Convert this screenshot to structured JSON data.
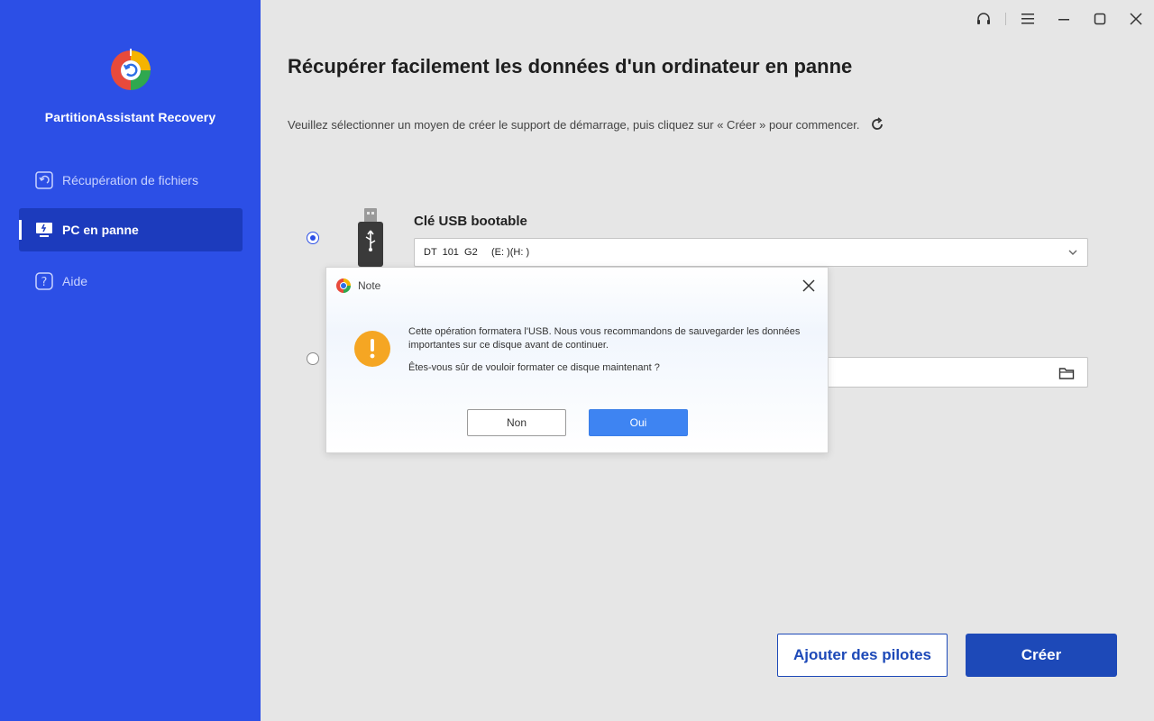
{
  "sidebar": {
    "app_name": "PartitionAssistant Recovery",
    "logo_icon": "recovery-logo-icon",
    "items": [
      {
        "label": "Récupération de fichiers",
        "icon": "file-restore-icon",
        "active": false
      },
      {
        "label": "PC en panne",
        "icon": "broken-pc-icon",
        "active": true
      },
      {
        "label": "Aide",
        "icon": "help-icon",
        "active": false
      }
    ]
  },
  "titlebar": {
    "icons": [
      "headset-icon",
      "menu-icon",
      "minimize-icon",
      "maximize-icon",
      "close-icon"
    ]
  },
  "main": {
    "title": "Récupérer facilement les données d'un ordinateur en panne",
    "subtitle": "Veuillez sélectionner un moyen de créer le support de démarrage, puis cliquez sur « Créer » pour commencer.",
    "usb_option": {
      "label": "Clé USB bootable",
      "selected": true,
      "select_value": "DT  101  G2     (E: )(H: )"
    },
    "iso_option": {
      "selected": false
    },
    "buttons": {
      "drivers": "Ajouter des pilotes",
      "create": "Créer"
    }
  },
  "dialog": {
    "title": "Note",
    "message": "Cette opération formatera l'USB. Nous vous recommandons de sauvegarder les données importantes sur ce disque avant de continuer.",
    "question": "Êtes-vous sûr de vouloir formater ce disque maintenant ?",
    "buttons": {
      "no": "Non",
      "yes": "Oui"
    }
  },
  "colors": {
    "sidebar_bg": "#2c4fe6",
    "sidebar_active": "#1c3bbd",
    "primary_button": "#1d49b8",
    "dialog_yes": "#3e84f2",
    "warning": "#f5a623"
  }
}
